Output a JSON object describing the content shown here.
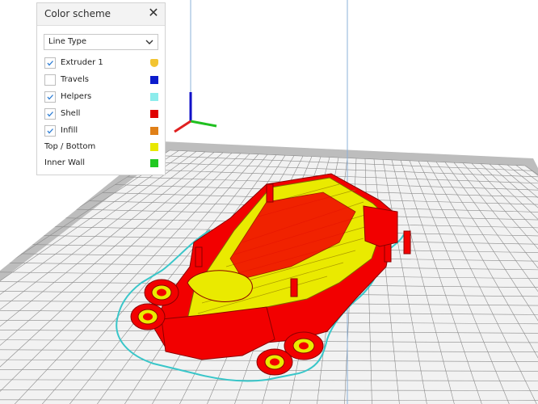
{
  "panel": {
    "title": "Color scheme",
    "close_glyph": "✕",
    "dropdown": {
      "selected": "Line Type"
    },
    "rows": [
      {
        "label": "Extruder 1",
        "checkbox": true,
        "checked": true,
        "color": "#f2c431"
      },
      {
        "label": "Travels",
        "checkbox": true,
        "checked": false,
        "color": "#0c1ccc"
      },
      {
        "label": "Helpers",
        "checkbox": true,
        "checked": true,
        "color": "#8cecec"
      },
      {
        "label": "Shell",
        "checkbox": true,
        "checked": true,
        "color": "#e00000"
      },
      {
        "label": "Infill",
        "checkbox": true,
        "checked": true,
        "color": "#e08018"
      },
      {
        "label": "Top / Bottom",
        "checkbox": false,
        "checked": false,
        "color": "#e8e800"
      },
      {
        "label": "Inner Wall",
        "checkbox": false,
        "checked": false,
        "color": "#20c820"
      }
    ]
  },
  "viewport": {
    "background": "#ffffff",
    "bed_color": "#d5d5d5",
    "grid_line_color": "#7d7d7d",
    "skirt_color": "#39c6c9",
    "model_shell_color": "#f20000",
    "model_top_color": "#eaea00",
    "model_edge_color": "#7a6a00",
    "axis_colors": {
      "x": "#e02020",
      "y": "#20c020",
      "z": "#1010c8"
    }
  }
}
